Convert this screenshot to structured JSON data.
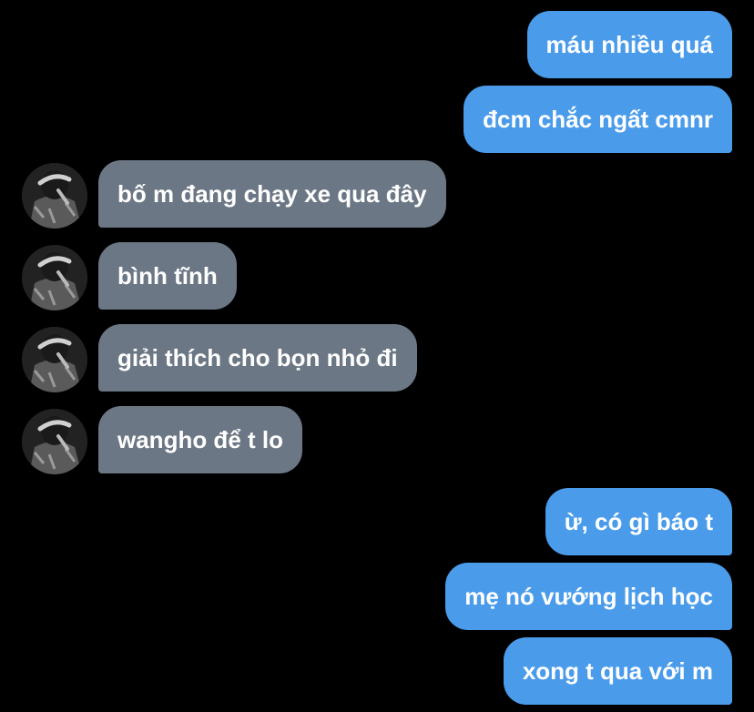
{
  "conversation": {
    "messages": [
      {
        "side": "sent",
        "text": "máu nhiều quá"
      },
      {
        "side": "sent",
        "text": "đcm chắc ngất cmnr"
      },
      {
        "side": "received",
        "text": "bố m đang chạy xe qua đây"
      },
      {
        "side": "received",
        "text": "bình tĩnh"
      },
      {
        "side": "received",
        "text": "giải thích cho bọn nhỏ đi"
      },
      {
        "side": "received",
        "text": "wangho để t lo"
      },
      {
        "side": "sent",
        "text": "ừ, có gì báo t"
      },
      {
        "side": "sent",
        "text": "mẹ nó vướng lịch học"
      },
      {
        "side": "sent",
        "text": "xong t qua với m"
      }
    ]
  },
  "colors": {
    "background": "#000000",
    "sent_bubble": "#4a9ceb",
    "received_bubble": "#6c7785",
    "text": "#ffffff"
  },
  "icons": {
    "avatar": "contact-avatar-photo"
  }
}
